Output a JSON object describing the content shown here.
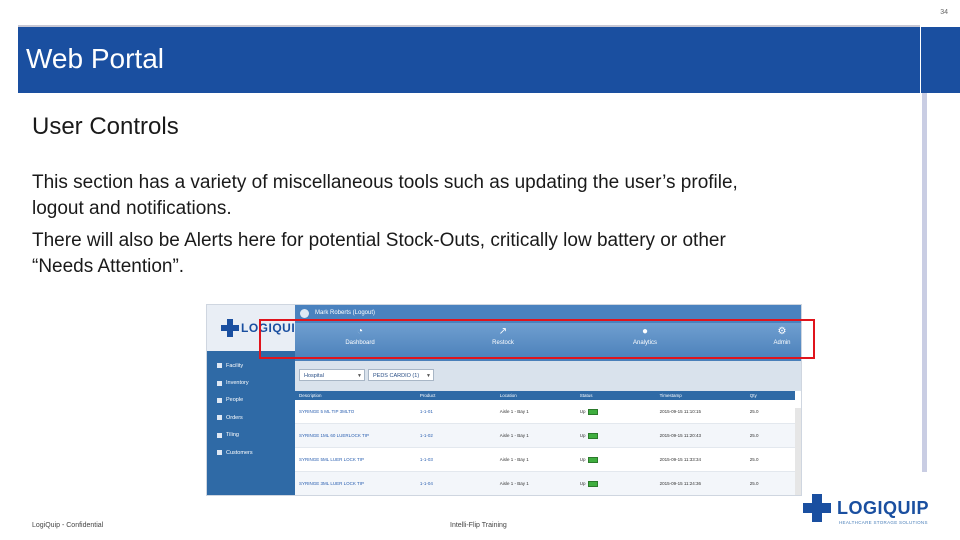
{
  "slide": {
    "number": "34",
    "title": "Web Portal",
    "subheading": "User Controls",
    "paragraphs": [
      "This section has a variety of miscellaneous tools such as updating the user’s profile, logout and notifications.",
      "There will also be Alerts here for potential Stock-Outs, critically low battery or other “Needs Attention”."
    ],
    "footer_left": "LogiQuip - Confidential",
    "footer_center": "Intelli-Flip Training",
    "brand_name": "LOGIQUIP",
    "brand_tagline": "HEALTHCARE STORAGE SOLUTIONS"
  },
  "screenshot": {
    "logo_text": "LOGIQUIP",
    "user_label": "Mark Roberts (Logout)",
    "sidebar": [
      {
        "label": "Facility",
        "icon": "building-icon"
      },
      {
        "label": "Inventory",
        "icon": "list-icon"
      },
      {
        "label": "People",
        "icon": "person-icon"
      },
      {
        "label": "Orders",
        "icon": "document-icon"
      },
      {
        "label": "Tiling",
        "icon": "chart-icon"
      },
      {
        "label": "Customers",
        "icon": "people-icon"
      }
    ],
    "tabs": [
      {
        "label": "Dashboard",
        "icon": "gauge-icon"
      },
      {
        "label": "Restock",
        "icon": "trend-icon"
      },
      {
        "label": "Analytics",
        "icon": "person-icon"
      },
      {
        "label": "Admin",
        "icon": "gear-icon"
      }
    ],
    "filter_1": "Hospital",
    "filter_2": "PEDS CARDIO (1)",
    "columns": [
      "Description",
      "Product",
      "Location",
      "Status",
      "Timestamp",
      "Qty"
    ],
    "rows": [
      {
        "description": "SYRINGE 5 ML TIP 3MLTO",
        "product": "1-1-01",
        "location": "Aisle 1 - Bay 1",
        "status": "Up",
        "timestamp": "2015-09-15 11:10:15",
        "qty": "25.0"
      },
      {
        "description": "SYRINGE 1ML 60 LUERLOCK TIP",
        "product": "1-1-02",
        "location": "Aisle 1 - Bay 1",
        "status": "Up",
        "timestamp": "2015-09-15 11:20:43",
        "qty": "25.0"
      },
      {
        "description": "SYRINGE 5ML LUER LOCK TIP",
        "product": "1-1-03",
        "location": "Aisle 1 - Bay 1",
        "status": "Up",
        "timestamp": "2015-09-15 11:33:34",
        "qty": "25.0"
      },
      {
        "description": "SYRINGE 3ML LUER LOCK TIP",
        "product": "1-1-04",
        "location": "Aisle 1 - Bay 1",
        "status": "Up",
        "timestamp": "2015-09-15 11:24:36",
        "qty": "25.0"
      }
    ]
  },
  "colors": {
    "title_bar": "#1a4fa0",
    "highlight": "#e0141c",
    "portal_blue": "#2f6aa6"
  }
}
